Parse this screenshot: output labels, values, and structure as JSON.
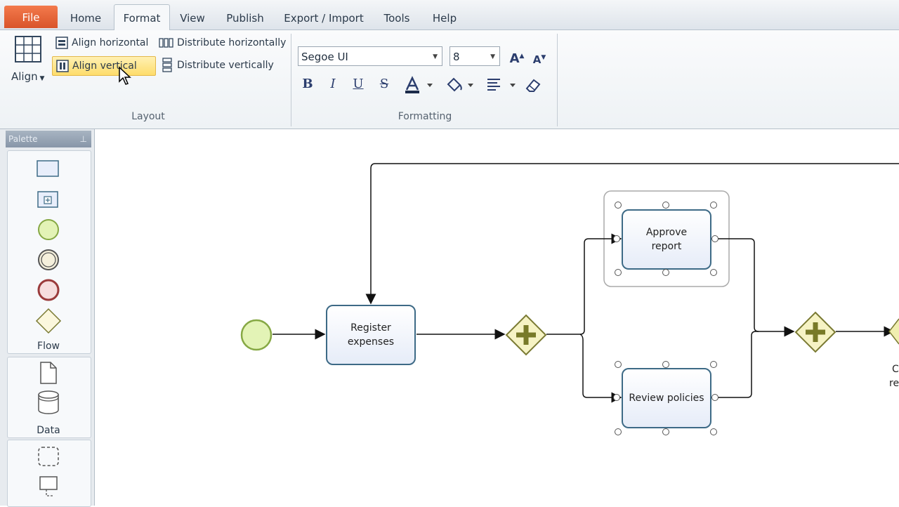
{
  "tabs": [
    {
      "label": "File"
    },
    {
      "label": "Home"
    },
    {
      "label": "Format"
    },
    {
      "label": "View"
    },
    {
      "label": "Publish"
    },
    {
      "label": "Export / Import"
    },
    {
      "label": "Tools"
    },
    {
      "label": "Help"
    }
  ],
  "active_tab": "Format",
  "ribbon": {
    "layout": {
      "align_label": "Align",
      "align_horizontal": "Align horizontal",
      "align_vertical": "Align vertical",
      "distribute_horizontally": "Distribute horizontally",
      "distribute_vertically": "Distribute vertically",
      "group_label": "Layout"
    },
    "formatting": {
      "font_family": "Segoe UI",
      "font_size": "8",
      "bold": "B",
      "italic": "I",
      "underline": "U",
      "strikethrough": "S",
      "group_label": "Formatting"
    }
  },
  "palette": {
    "header": "Palette",
    "sections": [
      {
        "label": "Flow",
        "items": [
          "task-shape",
          "subprocess-shape",
          "start-event",
          "intermediate-event",
          "end-event",
          "gateway"
        ]
      },
      {
        "label": "Data",
        "items": [
          "data-object",
          "data-store"
        ]
      },
      {
        "label": "",
        "items": [
          "group",
          "annotation"
        ]
      }
    ]
  },
  "diagram": {
    "tasks": {
      "register": "Register\nexpenses",
      "approve": "Approve\nreport",
      "review": "Review policies"
    },
    "partial_label_1": "C",
    "partial_label_2": "re"
  },
  "colors": {
    "file_tab": "#e2602f",
    "highlight": "#fedc6b",
    "task_border": "#3d6a86",
    "gateway_fill": "#f0eeb0",
    "gateway_border": "#7a7a33",
    "start_event_fill": "#e3f3b6",
    "start_event_border": "#86a844"
  }
}
